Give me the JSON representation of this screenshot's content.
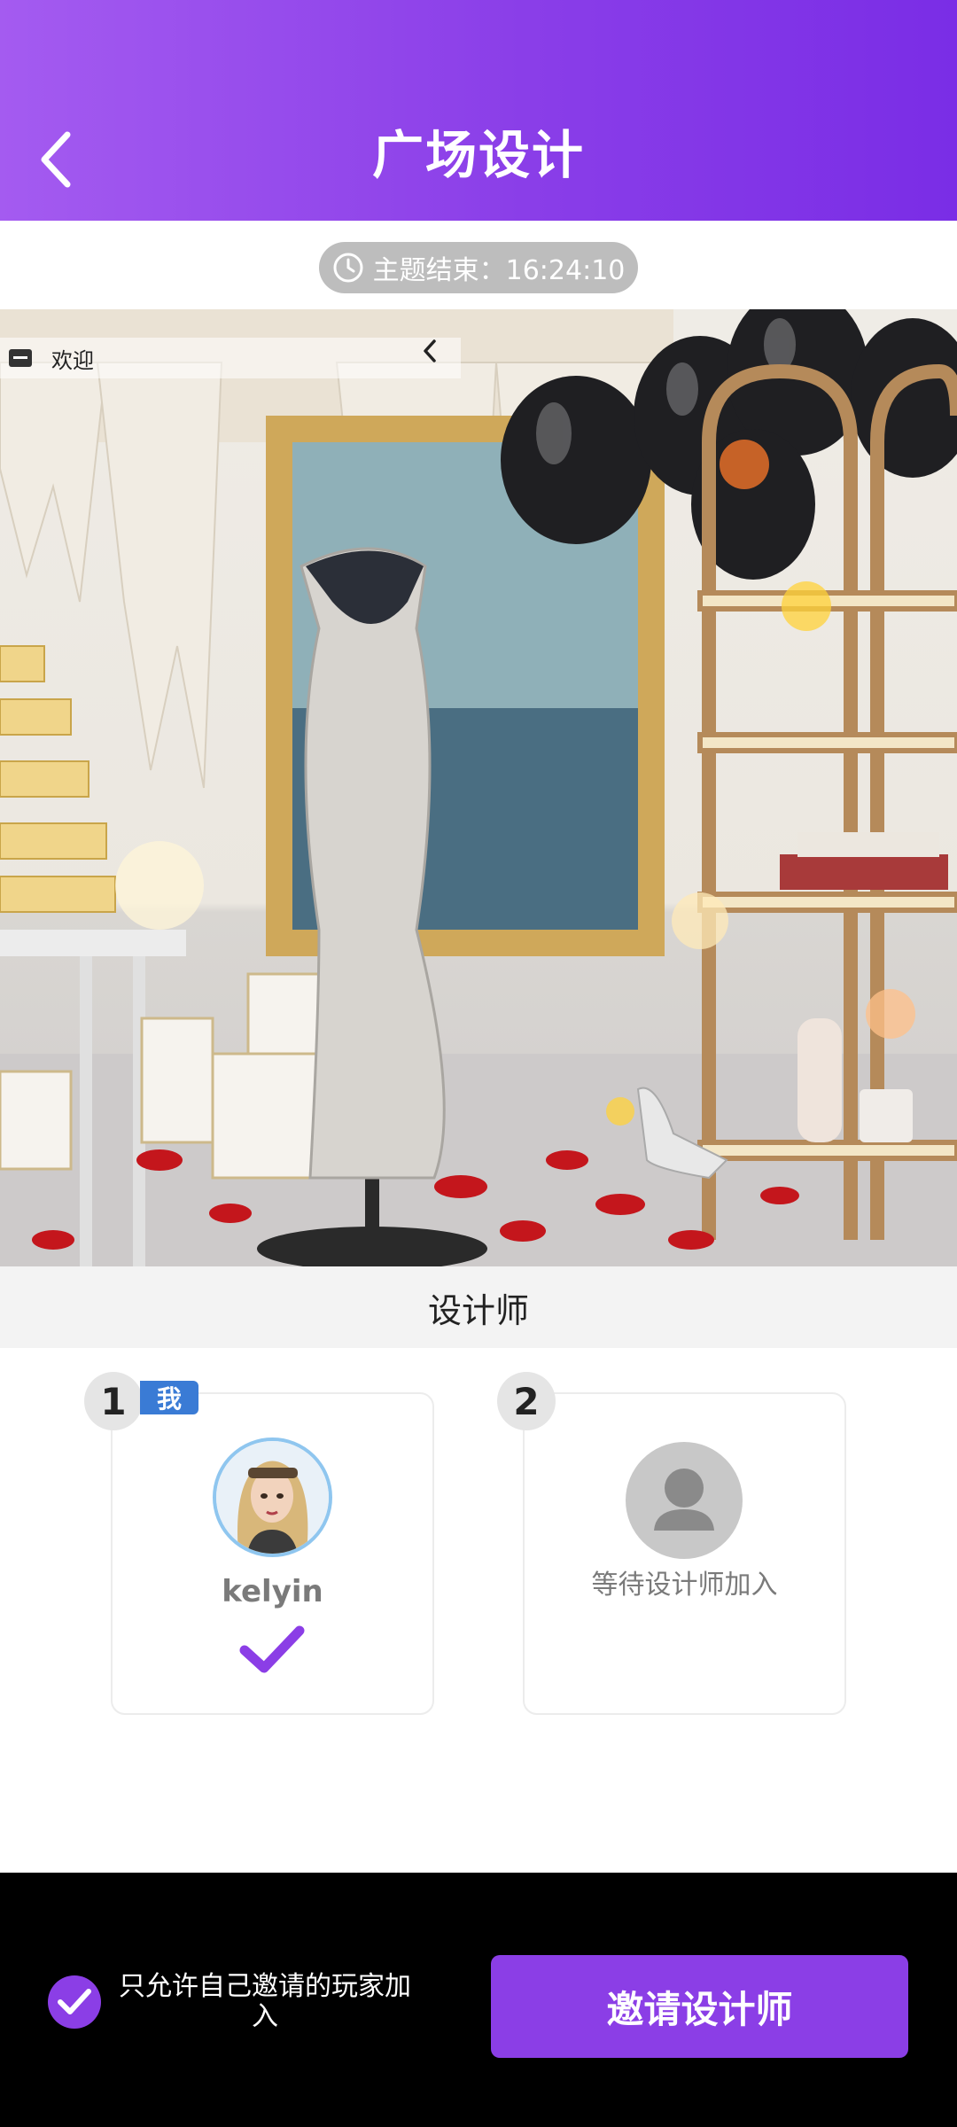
{
  "header": {
    "title": "广场设计",
    "back_icon": "chevron-left-icon"
  },
  "timer": {
    "label": "主题结束：",
    "value": "16:24:10",
    "icon": "clock-icon"
  },
  "scene": {
    "welcome_text": "欢迎",
    "collapse_icon": "chevron-left-icon"
  },
  "section": {
    "title": "设计师"
  },
  "designers": [
    {
      "rank": "1",
      "tag": "我",
      "name": "kelyin",
      "status_icon": "check-icon"
    },
    {
      "rank": "2",
      "placeholder_text": "等待设计师加入",
      "avatar_icon": "user-icon"
    }
  ],
  "footer": {
    "allow_only_invited_label": "只允许自己邀请的玩家加入",
    "allow_only_invited_checked": true,
    "invite_button_label": "邀请设计师"
  },
  "colors": {
    "accent": "#8b3ee6",
    "header_start": "#a45bf0",
    "header_end": "#7a2de6",
    "me_tag": "#3a7bd5"
  }
}
